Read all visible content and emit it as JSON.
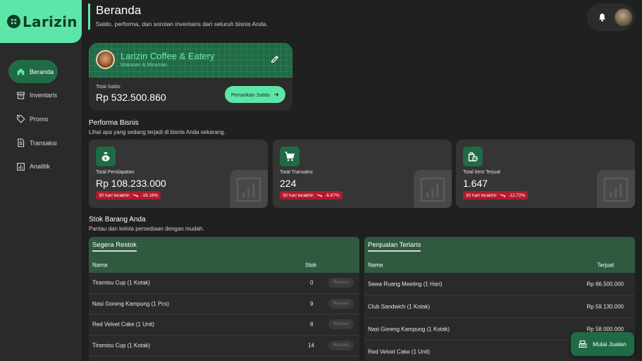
{
  "brand": {
    "name": "Larizin"
  },
  "nav": [
    {
      "label": "Beranda",
      "icon": "home-icon",
      "active": true
    },
    {
      "label": "Inventaris",
      "icon": "archive-icon"
    },
    {
      "label": "Promo",
      "icon": "tag-icon"
    },
    {
      "label": "Transaksi",
      "icon": "document-icon"
    },
    {
      "label": "Analitik",
      "icon": "chart-icon"
    }
  ],
  "header": {
    "title": "Beranda",
    "subtitle": "Saldo, performa, dan sorotan inventaris dari seluruh bisnis Anda."
  },
  "business": {
    "name": "Larizin Coffee & Eatery",
    "category": "Makanan & Minuman",
    "balance_label": "Total Saldo",
    "balance": "Rp 532.500.860",
    "withdraw_label": "Penarikan Saldo"
  },
  "performance": {
    "title": "Performa Bisnis",
    "subtitle": "Lihat apa yang sedang terjadi di bisnis Anda sekarang.",
    "stats": [
      {
        "label": "Total Pendapatan",
        "value": "Rp 108.233.000",
        "badge_prefix": "30 hari terakhir:",
        "change": "-16.16%",
        "icon": "money-bag-icon"
      },
      {
        "label": "Total Transaksi",
        "value": "224",
        "badge_prefix": "30 hari terakhir:",
        "change": "-6.67%",
        "icon": "cart-icon"
      },
      {
        "label": "Total Item Terjual",
        "value": "1.647",
        "badge_prefix": "30 hari terakhir:",
        "change": "-12.72%",
        "icon": "shopping-bag-icon"
      }
    ]
  },
  "stock": {
    "title": "Stok Barang Anda",
    "subtitle": "Pantau dan kelola persediaan dengan mudah.",
    "restock_panel": {
      "title": "Segera Restok",
      "col_name": "Nama",
      "col_stock": "Stok",
      "button_label": "Restock",
      "rows": [
        {
          "name": "Tiramisu Cup (1 Kotak)",
          "stock": "0"
        },
        {
          "name": "Nasi Goreng Kampung (1 Pcs)",
          "stock": "9"
        },
        {
          "name": "Red Velvet Cake (1 Unit)",
          "stock": "8"
        },
        {
          "name": "Tiramisu Cup (1 Kotak)",
          "stock": "14"
        }
      ]
    },
    "bestseller_panel": {
      "title": "Penjualan Terlaris",
      "col_name": "Nama",
      "col_sold": "Terjual",
      "rows": [
        {
          "name": "Sewa Ruang Meeting (1 Hari)",
          "sold": "Rp 66.500.000"
        },
        {
          "name": "Club Sandwich (1 Kotak)",
          "sold": "Rp 59.130.000"
        },
        {
          "name": "Nasi Goreng Kampung (1 Kotak)",
          "sold": "Rp 58.000.000"
        },
        {
          "name": "Red Velvet Cake (1 Unit)",
          "sold": ""
        }
      ]
    }
  },
  "fab": {
    "label": "Mulai Jualan"
  },
  "colors": {
    "accent": "#5de6a8",
    "brand_dark": "#1e6b45",
    "negative": "#b3192b"
  }
}
